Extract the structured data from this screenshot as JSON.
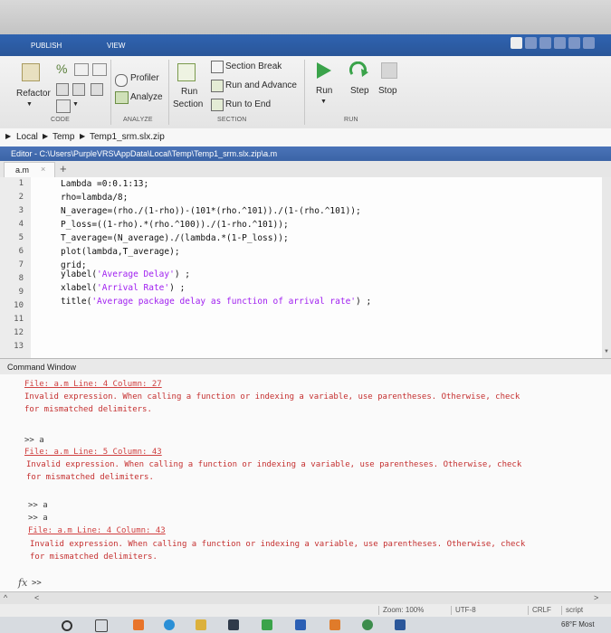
{
  "tabs": {
    "publish": "PUBLISH",
    "view": "VIEW"
  },
  "ribbon": {
    "refactor": "Refactor",
    "percent_glyph": "%",
    "profiler": "Profiler",
    "analyze": "Analyze",
    "run_section_1": "Run",
    "run_section_2": "Section",
    "section_break": "Section Break",
    "run_and_advance": "Run and Advance",
    "run_to_end": "Run to End",
    "run": "Run",
    "step": "Step",
    "stop": "Stop",
    "groups": {
      "code": "CODE",
      "analyze": "ANALYZE",
      "section": "SECTION",
      "run": "RUN"
    }
  },
  "breadcrumb": {
    "root": "Local",
    "c1": "Temp",
    "c2": "Temp1_srm.slx.zip"
  },
  "editor": {
    "title": "Editor - C:\\Users\\PurpleVRS\\AppData\\Local\\Temp\\Temp1_srm.slx.zip\\a.m",
    "tab_label": "a.m",
    "tab_close": "×",
    "add_tab": "+",
    "line_numbers": [
      "1",
      "2",
      "3",
      "4",
      "5",
      "6",
      "7",
      "8",
      "9",
      "10",
      "11",
      "12",
      "13"
    ],
    "lines": [
      "Lambda =0:0.1:13;",
      "rho=lambda/8;",
      "N_average=(rho./(1-rho))-(101*(rho.^101))./(1-(rho.^101));",
      "P_loss=((1-rho).*(rho.^100))./(1-rho.^101));",
      "T_average=(N_average)./(lambda.*(1-P_loss));",
      "plot(lambda,T_average);",
      "grid;"
    ],
    "l8": {
      "pre": "ylabel(",
      "str": "'Average Delay'",
      "post": ") ;"
    },
    "l9": {
      "pre": "xlabel(",
      "str": "'Arrival Rate'",
      "post": ") ;"
    },
    "l10": {
      "pre": "title(",
      "str": "'Average package delay as function of arrival rate'",
      "post": ") ;"
    }
  },
  "command_window": {
    "title": "Command Window",
    "err1": {
      "link": "File: a.m Line: 4 Column: 27",
      "msg1": "Invalid expression. When calling a function or indexing a variable, use parentheses. Otherwise, check",
      "msg2": "for mismatched delimiters."
    },
    "prompt1": ">> a",
    "err2": {
      "link": "File: a.m Line: 5 Column: 43",
      "msg1": "Invalid expression. When calling a function or indexing a variable, use parentheses. Otherwise, check",
      "msg2": "for mismatched delimiters."
    },
    "prompt2": ">> a",
    "prompt3": ">> a",
    "err3": {
      "link": "File: a.m Line: 4 Column: 43",
      "msg1": "Invalid expression. When calling a function or indexing a variable, use parentheses. Otherwise, check",
      "msg2": "for mismatched delimiters."
    },
    "fx": "fx",
    "input_prompt": ">>"
  },
  "status": {
    "zoom": "Zoom: 100%",
    "encoding": "UTF-8",
    "eol": "CRLF",
    "type": "script"
  },
  "taskbar": {
    "weather": "68°F Most"
  },
  "colors": {
    "ribbon_blue": "#2f63b0",
    "error_red": "#c53030",
    "string_purple": "#a020f0"
  }
}
